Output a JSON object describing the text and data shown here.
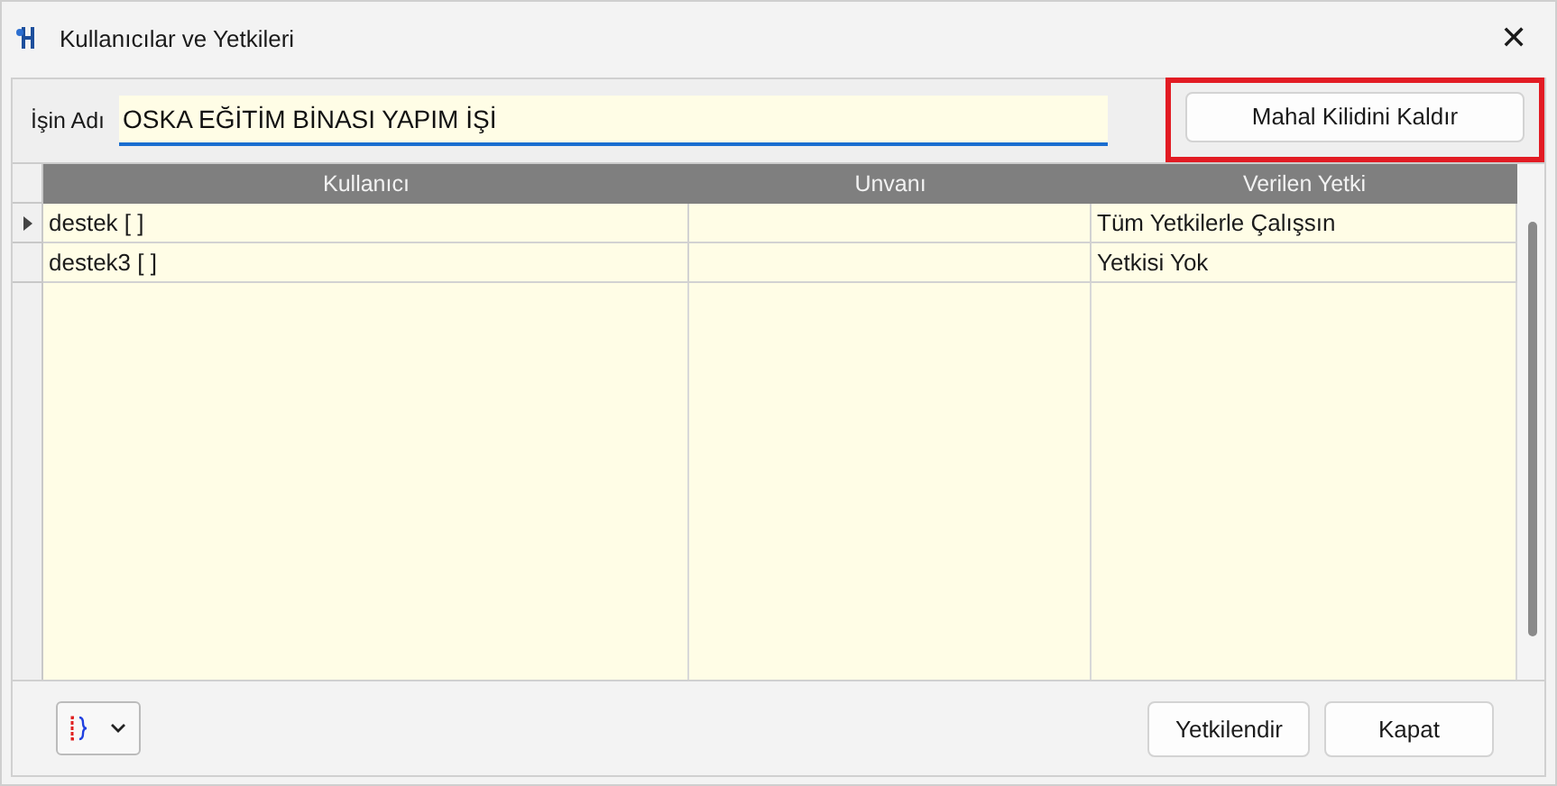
{
  "window": {
    "title": "Kullanıcılar ve Yetkileri",
    "close": "✕"
  },
  "job_field": {
    "label": "İşin Adı",
    "value": "OSKA EĞİTİM BİNASI YAPIM İŞİ"
  },
  "unlock_button": {
    "label": "Mahal Kilidini Kaldır",
    "highlighted": true
  },
  "table": {
    "columns": [
      "Kullanıcı",
      "Unvanı",
      "Verilen Yetki"
    ],
    "rows": [
      {
        "cells": [
          "destek [ ]",
          "",
          "Tüm Yetkilerle Çalışsın"
        ],
        "selected": true
      },
      {
        "cells": [
          "destek3 [ ]",
          "",
          "Yetkisi Yok"
        ],
        "selected": false
      }
    ]
  },
  "buttons": [
    "Yetkilendir",
    "Kapat"
  ]
}
